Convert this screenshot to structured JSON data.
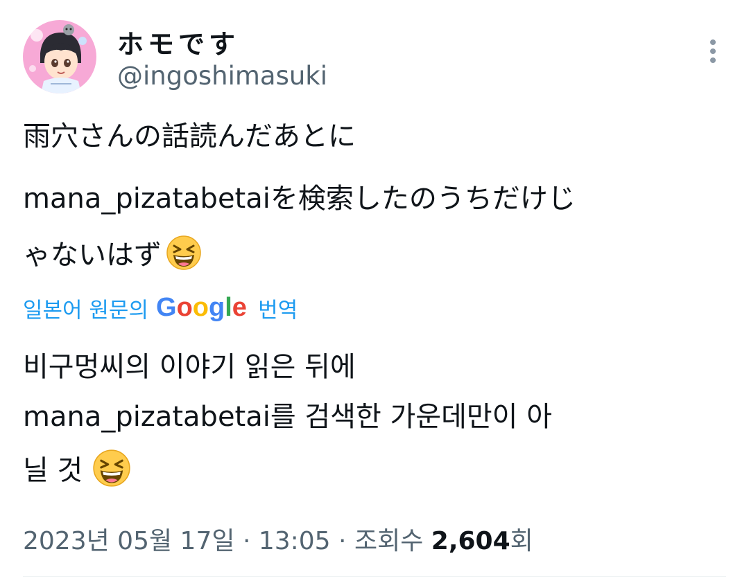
{
  "author": {
    "display_name": "ホモです",
    "handle": "@ingoshimasuki"
  },
  "tweet": {
    "original_lines": [
      "雨穴さんの話読んだあとに",
      "mana_pizatabetaiを検索したのうちだけじ",
      "ゃないはず"
    ],
    "translated_lines": [
      "비구멍씨의 이야기 읽은 뒤에",
      "mana_pizatabetai를 검색한 가운데만이 아",
      "닐 것"
    ],
    "emoji": "grinning-squinting-face-icon"
  },
  "translation_bar": {
    "prefix": "일본어 원문의",
    "brand": "Google",
    "suffix": "번역"
  },
  "meta": {
    "date": "2023년 05월 17일",
    "separator": "·",
    "time": "13:05",
    "views_label": "조회수",
    "views_count": "2,604",
    "views_suffix": "회"
  },
  "colors": {
    "text": "#0f1419",
    "secondary": "#536471",
    "link": "#1d9bf0"
  }
}
